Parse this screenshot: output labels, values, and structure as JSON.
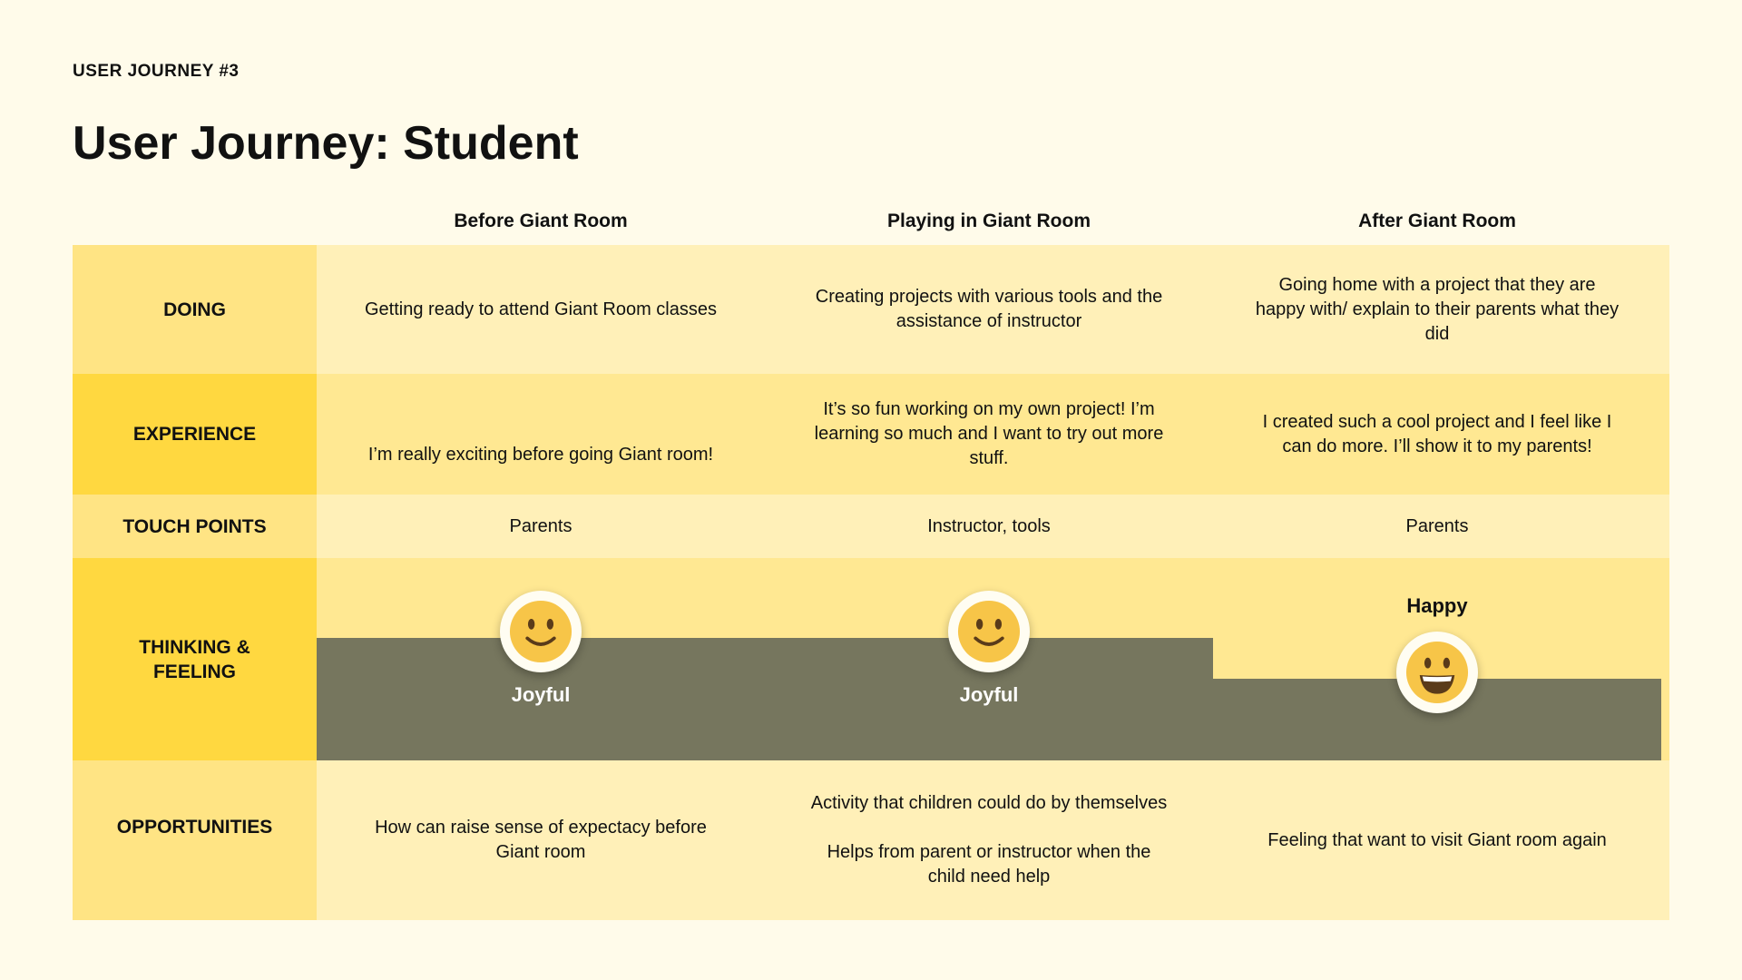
{
  "header": {
    "eyebrow": "USER JOURNEY #3",
    "title": "User Journey: Student"
  },
  "stages": [
    "Before Giant Room",
    "Playing in Giant Room",
    "After Giant Room"
  ],
  "rows": {
    "doing": {
      "label": "DOING",
      "cells": [
        "Getting ready to attend Giant Room classes",
        "Creating projects with various tools and the assistance of instructor",
        "Going home with a project that they are happy with/ explain to their parents what they did"
      ]
    },
    "experience": {
      "label": "EXPERIENCE",
      "cells": [
        "I’m really exciting before going Giant room!",
        "It’s so fun working on my own project! I’m learning so much and I want to try out more stuff.",
        "I created such a cool project and I feel like I can do more. I’ll show it to my parents!"
      ]
    },
    "touch_points": {
      "label": "TOUCH POINTS",
      "cells": [
        "Parents",
        "Instructor, tools",
        "Parents"
      ]
    },
    "thinking_feeling": {
      "label": "THINKING & FEELING",
      "feelings": [
        {
          "label": "Joyful",
          "emoji": "smiling-face-icon"
        },
        {
          "label": "Joyful",
          "emoji": "smiling-face-icon"
        },
        {
          "label": "Happy",
          "emoji": "grinning-face-icon"
        }
      ]
    },
    "opportunities": {
      "label": "OPPORTUNITIES",
      "cells": [
        "How can raise sense of expectacy before Giant room",
        "Activity that children could do by themselves\n\nHelps from parent or instructor when the child need help",
        "Feeling that want to visit Giant room again"
      ]
    }
  },
  "colors": {
    "background": "#fffbea",
    "cell_light": "#fff0b8",
    "cell_mid": "#ffe892",
    "label_light": "#ffe484",
    "label_strong": "#ffd840",
    "feeling_band": "#76765e",
    "emoji_face": "#f7c548"
  }
}
